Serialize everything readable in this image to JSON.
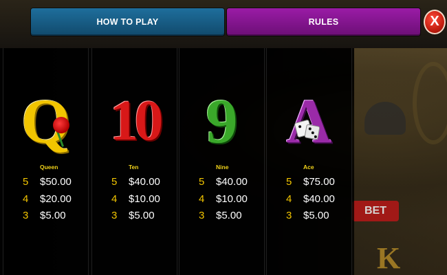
{
  "tabs": {
    "how_to_play": "HOW TO PLAY",
    "rules": "RULES",
    "close": "X"
  },
  "background": {
    "bet_label": "BET",
    "k_symbol": "K"
  },
  "paytable": [
    {
      "symbol": "Q",
      "name": "Queen",
      "color": "#f2c500",
      "pays": [
        {
          "count": "5",
          "amount": "$50.00"
        },
        {
          "count": "4",
          "amount": "$20.00"
        },
        {
          "count": "3",
          "amount": "$5.00"
        }
      ]
    },
    {
      "symbol": "10",
      "name": "Ten",
      "color": "#d81818",
      "pays": [
        {
          "count": "5",
          "amount": "$40.00"
        },
        {
          "count": "4",
          "amount": "$10.00"
        },
        {
          "count": "3",
          "amount": "$5.00"
        }
      ]
    },
    {
      "symbol": "9",
      "name": "Nine",
      "color": "#3aa82a",
      "pays": [
        {
          "count": "5",
          "amount": "$40.00"
        },
        {
          "count": "4",
          "amount": "$10.00"
        },
        {
          "count": "3",
          "amount": "$5.00"
        }
      ]
    },
    {
      "symbol": "A",
      "name": "Ace",
      "color": "#9a2aa8",
      "pays": [
        {
          "count": "5",
          "amount": "$75.00"
        },
        {
          "count": "4",
          "amount": "$40.00"
        },
        {
          "count": "3",
          "amount": "$5.00"
        }
      ]
    }
  ]
}
